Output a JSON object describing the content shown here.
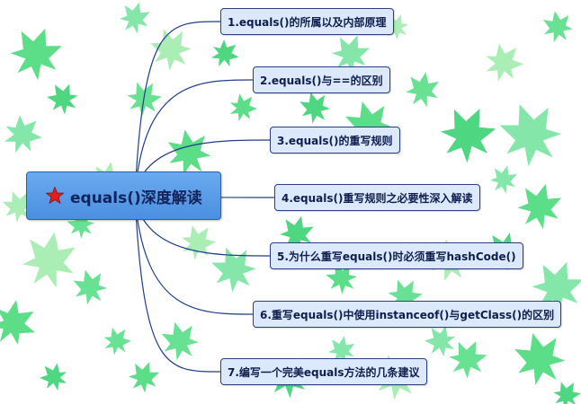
{
  "central": {
    "icon": "star-icon",
    "label": "equals()深度解读"
  },
  "topics": [
    {
      "label": "1.equals()的所属以及内部原理"
    },
    {
      "label": "2.equals()与==的区别"
    },
    {
      "label": "3.equals()的重写规则"
    },
    {
      "label": "4.equals()重写规则之必要性深入解读"
    },
    {
      "label": "5.为什么重写equals()时必须重写hashCode()"
    },
    {
      "label": "6.重写equals()中使用instanceof()与getClass()的区别"
    },
    {
      "label": "7.编写一个完美equals方法的几条建议"
    }
  ],
  "colors": {
    "central_fill": "#5b9be8",
    "topic_fill": "#dce8fb",
    "border": "#27407e",
    "connector": "#1f3f8a",
    "leaf_green": "#3fd873",
    "star_red": "#e01e1e"
  }
}
